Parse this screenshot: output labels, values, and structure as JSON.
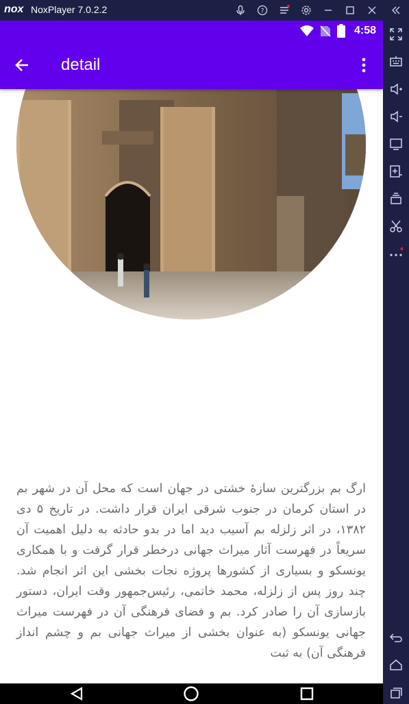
{
  "window": {
    "logo": "nox",
    "title": "NoxPlayer 7.0.2.2",
    "buttons": [
      "microphone-icon",
      "help-icon",
      "menu-icon",
      "settings-icon",
      "minimize-icon",
      "maximize-icon",
      "close-icon",
      "collapse-icon"
    ]
  },
  "status_bar": {
    "time": "4:58",
    "icons": [
      "wifi-icon",
      "sim-icon",
      "battery-icon"
    ]
  },
  "app_bar": {
    "title": "detail",
    "back_icon": "arrow-left-icon",
    "overflow_icon": "more-vert-icon",
    "color": "#6200ee"
  },
  "article": {
    "image_subject": "arg-e-bam-citadel",
    "body": "ارگ بم بزرگترین سازهٔ خشتی در جهان است که محل آن در شهر بم در استان کرمان در جنوب شرقی ایران قرار داشت. در تاریخ ۵ دی ۱۳۸۲، در اثر زلزله بم آسیب دید اما در بدو حادثه به دلیل اهمیت آن سریعاً در فهرست آثار میراث جهانی درخطر قرار گرفت و با همکاری یونسکو و بسیاری از کشورها پروژه نجات بخشی این اثر انجام شد. چند روز پس از زلزله، محمد خاتمی، رئیس‌جمهور وقت ایران، دستور بازسازی آن را صادر کرد. بم و فضای فرهنگی آن در فهرست میراث جهانی یونسکو (به عنوان بخشی از میراث جهانی بم و چشم انداز فرهنگی آن) به ثبت"
  },
  "nav_bar": [
    "back-triangle-icon",
    "home-circle-icon",
    "recents-square-icon"
  ],
  "side_toolbar": [
    "fullscreen-icon",
    "keyboard-icon",
    "volume-up-icon",
    "volume-down-icon",
    "screen-icon",
    "apk-install-icon",
    "multi-instance-icon",
    "scissors-icon",
    "more-dots-icon",
    "back-icon",
    "home-icon",
    "recents-icon"
  ]
}
